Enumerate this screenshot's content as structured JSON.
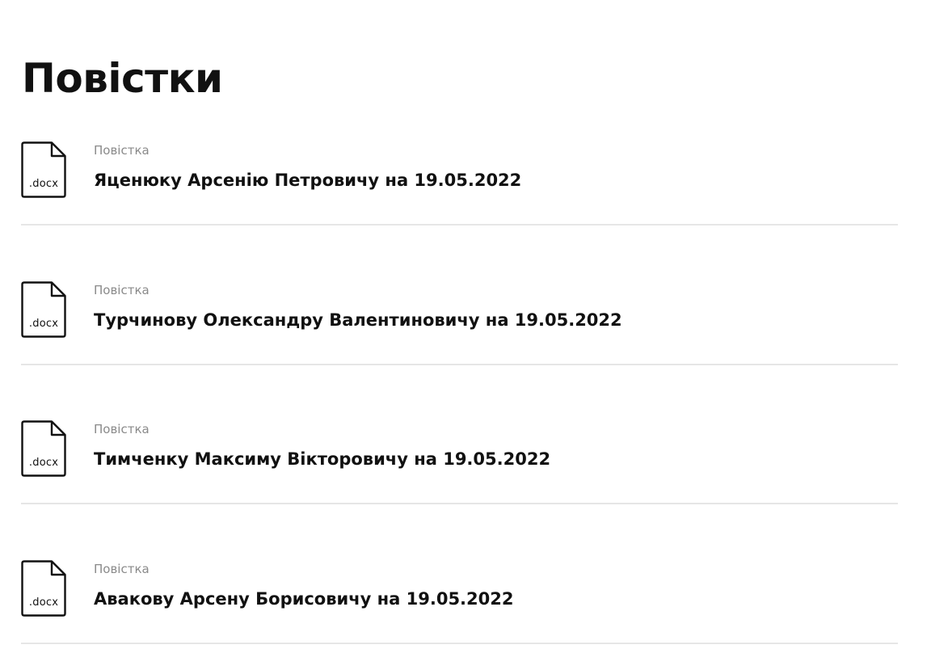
{
  "page": {
    "title": "Повістки"
  },
  "documents": [
    {
      "extension": ".docx",
      "icon": "docx-file-icon",
      "caption": "Повістка",
      "name": "Яценюку Арсенію Петровичу на 19.05.2022"
    },
    {
      "extension": ".docx",
      "icon": "docx-file-icon",
      "caption": "Повістка",
      "name": "Турчинову Олександру Валентиновичу на 19.05.2022"
    },
    {
      "extension": ".docx",
      "icon": "docx-file-icon",
      "caption": "Повістка",
      "name": "Тимченку Максиму Вікторовичу на 19.05.2022"
    },
    {
      "extension": ".docx",
      "icon": "docx-file-icon",
      "caption": "Повістка",
      "name": "Авакову Арсену Борисовичу на 19.05.2022"
    }
  ],
  "colors": {
    "text": "#111111",
    "caption": "#8a8a8a",
    "divider": "#e6e6e6"
  }
}
